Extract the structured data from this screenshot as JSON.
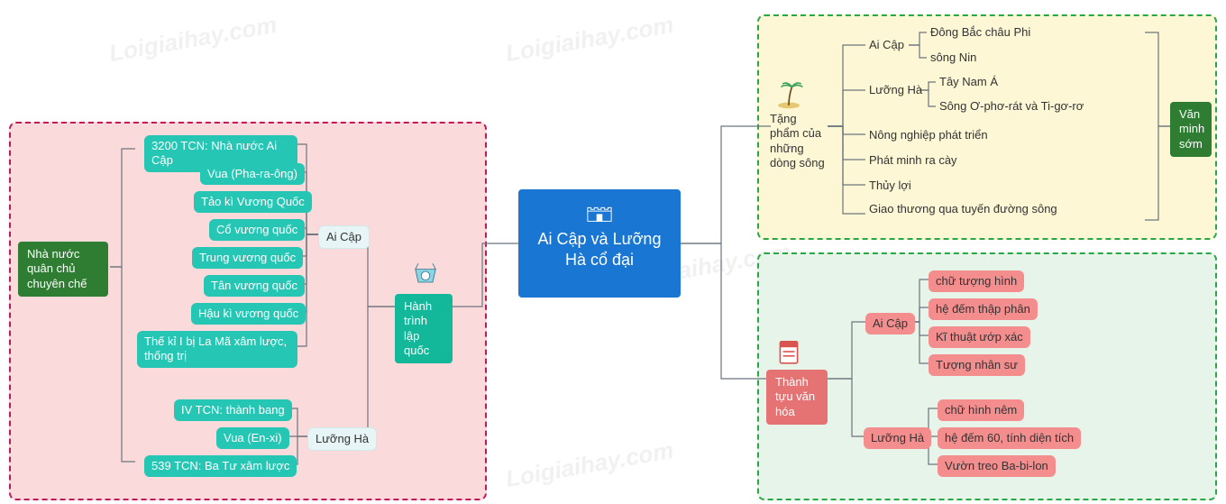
{
  "watermark": "Loigiaihay.com",
  "center": {
    "title": "Ai Cập và Lưỡng Hà cổ đại",
    "icon": "castle-icon"
  },
  "left": {
    "icon": "gong-icon",
    "header": "Hành trình lập quốc",
    "branches": [
      {
        "label": "Ai Cập",
        "items": [
          "3200 TCN: Nhà nước Ai Cập",
          "Vua (Pha-ra-ông)",
          "Tảo kì Vương Quốc",
          "Cổ vương quốc",
          "Trung vương quốc",
          "Tân vương quốc",
          "Hậu kì vương quốc",
          "Thế kỉ I bị La Mã xâm lược, thống trị"
        ]
      },
      {
        "label": "Lưỡng Hà",
        "items": [
          "IV TCN: thành bang",
          "Vua (En-xi)",
          "539 TCN: Ba Tư xâm lược"
        ]
      }
    ],
    "far_label": "Nhà nước quân chủ chuyên chế"
  },
  "top_right": {
    "icon": "palm-icon",
    "header": "Tặng phẩm của những dòng sông",
    "branches": [
      {
        "label": "Ai Cập",
        "items": [
          "Đông Bắc châu Phi",
          "sông Nin"
        ]
      },
      {
        "label": "Lưỡng Hà",
        "items": [
          "Tây Nam Á",
          "Sông Ơ-phơ-rát và Ti-gơ-rơ"
        ]
      }
    ],
    "plain_items": [
      "Nông nghiệp phát triển",
      "Phát minh ra cày",
      "Thủy lợi",
      "Giao thương qua tuyến đường sông"
    ],
    "far_label": "Văn minh sớm"
  },
  "bottom_right": {
    "icon": "document-icon",
    "header": "Thành tựu văn hóa",
    "branches": [
      {
        "label": "Ai Cập",
        "items": [
          "chữ tượng hình",
          "hệ đếm thập phân",
          "Kĩ thuật ướp xác",
          "Tượng nhân sư"
        ]
      },
      {
        "label": "Lưỡng Hà",
        "items": [
          "chữ hình nêm",
          "hệ đếm 60, tính diện tích",
          "Vườn treo Ba-bi-lon"
        ]
      }
    ]
  },
  "colors": {
    "center": "#1976d2",
    "teal": "#26c6b5",
    "salmon": "#f48e8e",
    "green": "#2e7d32"
  }
}
